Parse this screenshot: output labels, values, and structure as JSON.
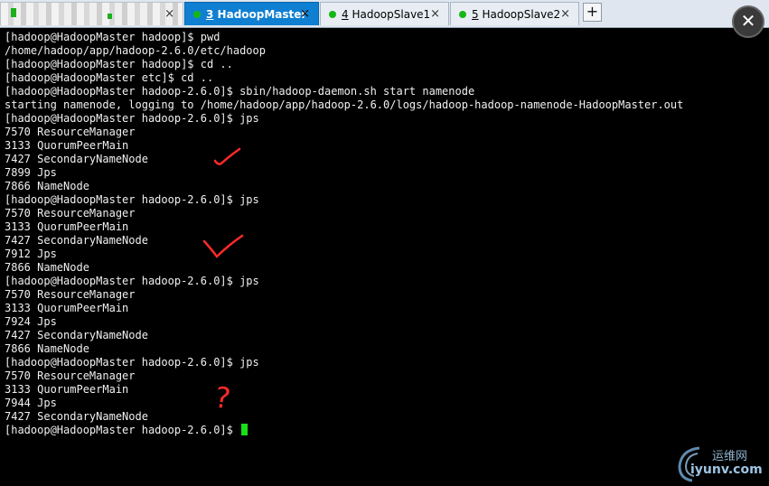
{
  "tabs": [
    {
      "number": "3",
      "name": "HadoopMaster",
      "active": true
    },
    {
      "number": "4",
      "name": "HadoopSlave1",
      "active": false
    },
    {
      "number": "5",
      "name": "HadoopSlave2",
      "active": false
    }
  ],
  "tab_close_glyph": "×",
  "new_tab_glyph": "+",
  "window_close_glyph": "✕",
  "terminal": {
    "lines": [
      "[hadoop@HadoopMaster hadoop]$ pwd",
      "/home/hadoop/app/hadoop-2.6.0/etc/hadoop",
      "[hadoop@HadoopMaster hadoop]$ cd ..",
      "[hadoop@HadoopMaster etc]$ cd ..",
      "[hadoop@HadoopMaster hadoop-2.6.0]$ sbin/hadoop-daemon.sh start namenode",
      "starting namenode, logging to /home/hadoop/app/hadoop-2.6.0/logs/hadoop-hadoop-namenode-HadoopMaster.out",
      "[hadoop@HadoopMaster hadoop-2.6.0]$ jps",
      "7570 ResourceManager",
      "3133 QuorumPeerMain",
      "7427 SecondaryNameNode",
      "7899 Jps",
      "7866 NameNode",
      "[hadoop@HadoopMaster hadoop-2.6.0]$ jps",
      "7570 ResourceManager",
      "3133 QuorumPeerMain",
      "7427 SecondaryNameNode",
      "7912 Jps",
      "7866 NameNode",
      "[hadoop@HadoopMaster hadoop-2.6.0]$ jps",
      "7570 ResourceManager",
      "3133 QuorumPeerMain",
      "7924 Jps",
      "7427 SecondaryNameNode",
      "7866 NameNode",
      "[hadoop@HadoopMaster hadoop-2.6.0]$ jps",
      "7570 ResourceManager",
      "3133 QuorumPeerMain",
      "7944 Jps",
      "7427 SecondaryNameNode"
    ],
    "prompt": "[hadoop@HadoopMaster hadoop-2.6.0]$ "
  },
  "annotations": {
    "question_mark": "?"
  },
  "watermark": {
    "cn": "运维网",
    "en": "iyunv.com"
  },
  "colors": {
    "active_tab": "#0f7fd2",
    "status_dot": "#14b814",
    "cursor": "#19e019",
    "annotation_red": "#ff2a2a"
  }
}
